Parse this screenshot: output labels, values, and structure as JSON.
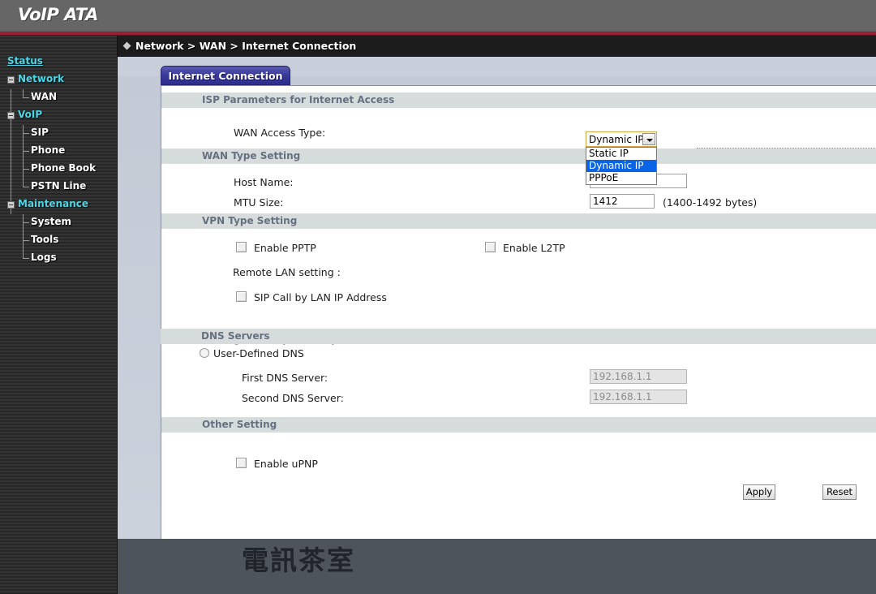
{
  "header": {
    "title": "VoIP ATA"
  },
  "breadcrumb": {
    "text": "Network > WAN > Internet Connection",
    "marker": "diamond-icon"
  },
  "sidebar": {
    "items": [
      {
        "label": "Status",
        "level": "top"
      },
      {
        "label": "Network",
        "level": "root"
      },
      {
        "label": "WAN",
        "level": "child"
      },
      {
        "label": "VoIP",
        "level": "root"
      },
      {
        "label": "SIP",
        "level": "child"
      },
      {
        "label": "Phone",
        "level": "child"
      },
      {
        "label": "Phone Book",
        "level": "child"
      },
      {
        "label": "PSTN Line",
        "level": "child"
      },
      {
        "label": "Maintenance",
        "level": "root"
      },
      {
        "label": "System",
        "level": "child"
      },
      {
        "label": "Tools",
        "level": "child"
      },
      {
        "label": "Logs",
        "level": "child"
      }
    ]
  },
  "tab": {
    "label": "Internet Connection"
  },
  "sections": {
    "isp": {
      "title": "ISP Parameters for Internet Access"
    },
    "wan_type": {
      "title": "WAN Type Setting"
    },
    "vpn_type": {
      "title": "VPN Type Setting"
    },
    "dns": {
      "title": "DNS Servers"
    },
    "other": {
      "title": "Other Setting"
    }
  },
  "fields": {
    "wan_access_type": {
      "label": "WAN Access Type:",
      "value": "Dynamic IP",
      "options": [
        "Static IP",
        "Dynamic IP",
        "PPPoE"
      ],
      "expanded": true
    },
    "host_name": {
      "label": "Host Name:",
      "value": ""
    },
    "mtu_size": {
      "label": "MTU Size:",
      "value": "1412",
      "hint": "(1400-1492 bytes)"
    },
    "enable_pptp": {
      "label": "Enable PPTP",
      "checked": false
    },
    "enable_l2tp": {
      "label": "Enable L2TP",
      "checked": false
    },
    "remote_lan_setting": {
      "label": "Remote LAN setting :"
    },
    "sip_call_by_lan_ip": {
      "label": "SIP Call by LAN IP Address",
      "checked": false
    },
    "assign_dns_dynamically": {
      "label": "Assign DNS Dynamically",
      "selected": true
    },
    "user_defined_dns": {
      "label": "User-Defined DNS",
      "selected": false
    },
    "first_dns_server": {
      "label": "First DNS Server:",
      "value": "192.168.1.1",
      "disabled": true
    },
    "second_dns_server": {
      "label": "Second DNS Server:",
      "value": "192.168.1.1",
      "disabled": true
    },
    "enable_upnp": {
      "label": "Enable uPNP",
      "checked": false
    }
  },
  "buttons": {
    "apply": "Apply",
    "reset": "Reset"
  },
  "watermark": {
    "text": "電訊茶室"
  },
  "colors": {
    "header_bg": "#666666",
    "header_rule": "#9c1c33",
    "sidebar_bg": "#2d2d2d",
    "nav_accent": "#4ad8e8",
    "tab_bg": "#3b3b9c",
    "section_bg": "#d6dcdc",
    "section_text": "#667080",
    "page_bg": "#c9cfda",
    "select_focus_border": "#d9a441",
    "option_selected_bg": "#0a64e6"
  }
}
